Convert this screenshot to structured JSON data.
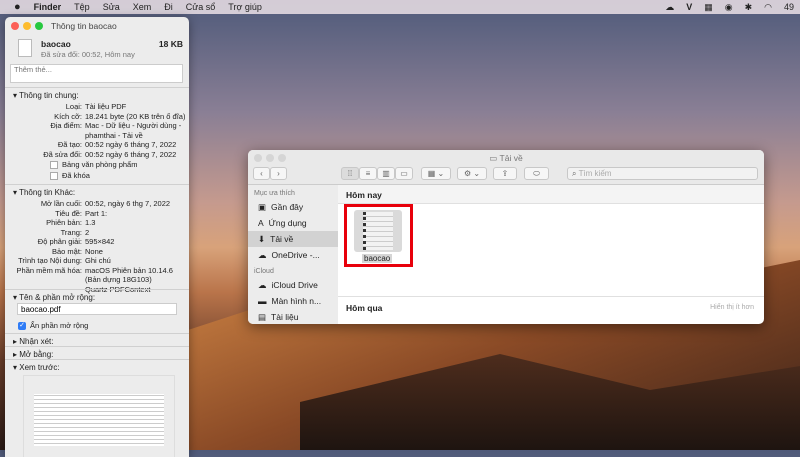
{
  "menubar": {
    "apple": "",
    "app": "Finder",
    "items": [
      "Tệp",
      "Sửa",
      "Xem",
      "Đi",
      "Cửa sổ",
      "Trợ giúp"
    ],
    "status_icons": [
      "cloud-icon",
      "v-icon",
      "grid-icon",
      "creative-cloud-icon",
      "bluetooth-icon",
      "wifi-icon"
    ],
    "battery": "49"
  },
  "info": {
    "title": "Thông tin baocao",
    "filename": "baocao",
    "size": "18 KB",
    "modified": "Đã sửa đổi: 00:52, Hôm nay",
    "tags_placeholder": "Thêm thẻ...",
    "general": {
      "heading": "Thông tin chung:",
      "rows": [
        {
          "k": "Loại:",
          "v": "Tài liệu PDF"
        },
        {
          "k": "Kích cỡ:",
          "v": "18.241 byte (20 KB trên ổ đĩa)"
        },
        {
          "k": "Địa điểm:",
          "v": "Mac - Dữ liệu - Người dùng -"
        },
        {
          "k": "",
          "v": "phamthai - Tải về"
        },
        {
          "k": "Đã tạo:",
          "v": "00:52 ngày 6 tháng 7, 2022"
        },
        {
          "k": "Đã sửa đổi:",
          "v": "00:52 ngày 6 tháng 7, 2022"
        }
      ],
      "stationery": "Bảng văn phòng phẩm",
      "locked": "Đã khóa"
    },
    "more": {
      "heading": "Thông tin Khác:",
      "rows": [
        {
          "k": "Mở lần cuối:",
          "v": "00:52, ngày 6 thg 7, 2022"
        },
        {
          "k": "Tiêu đề:",
          "v": "Part 1:"
        },
        {
          "k": "Phiên bản:",
          "v": "1.3"
        },
        {
          "k": "Trang:",
          "v": "2"
        },
        {
          "k": "Độ phân giải:",
          "v": "595×842"
        },
        {
          "k": "Bảo mật:",
          "v": "None"
        },
        {
          "k": "Trình tạo Nội dung:",
          "v": "Ghi chú"
        },
        {
          "k": "Phần mềm mã hóa:",
          "v": "macOS Phiên bản 10.14.6"
        },
        {
          "k": "",
          "v": "(Bản dựng 18G103)"
        },
        {
          "k": "",
          "v": "Quartz PDFContext"
        }
      ]
    },
    "name_ext": {
      "heading": "Tên & phần mở rộng:",
      "value": "baocao.pdf",
      "hide_ext": "Ẩn phần mở rộng"
    },
    "comments": "Nhận xét:",
    "open_with": "Mở bằng:",
    "preview": "Xem trước:"
  },
  "finder": {
    "title": "Tải về",
    "search_placeholder": "Tìm kiếm",
    "sidebar": {
      "favorites_heading": "Mục ưa thích",
      "favorites": [
        "Gần đây",
        "Ứng dụng",
        "Tải về",
        "OneDrive -..."
      ],
      "icloud_heading": "iCloud",
      "icloud": [
        "iCloud Drive",
        "Màn hình n...",
        "Tài liệu"
      ]
    },
    "groups": [
      {
        "label": "Hôm nay"
      },
      {
        "label": "Hôm qua",
        "action": "Hiển thị ít hơn"
      }
    ],
    "file": "baocao",
    "highlight_color": "#e8000b"
  }
}
